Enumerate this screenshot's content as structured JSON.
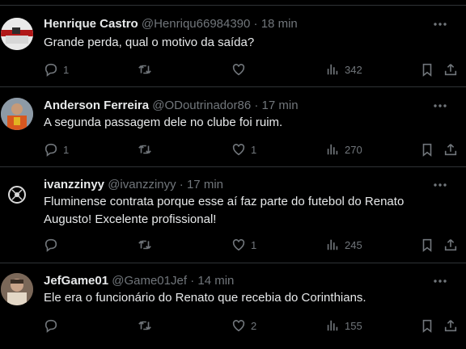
{
  "tweets": [
    {
      "name": "Henrique Castro",
      "handle": "@Henriqu66984390",
      "time": "18 min",
      "text": "Grande perda, qual o motivo da saída?",
      "replies": "1",
      "retweets": "",
      "likes": "",
      "views": "342"
    },
    {
      "name": "Anderson Ferreira",
      "handle": "@ODoutrinador86",
      "time": "17 min",
      "text": "A segunda passagem dele no clube foi ruim.",
      "replies": "1",
      "retweets": "",
      "likes": "1",
      "views": "270"
    },
    {
      "name": "ivanzzinyy",
      "handle": "@ivanzzinyy",
      "time": "17 min",
      "text": "Fluminense contrata porque esse aí faz parte do futebol do Renato Augusto! Excelente profissional!",
      "replies": "",
      "retweets": "",
      "likes": "1",
      "views": "245"
    },
    {
      "name": "JefGame01",
      "handle": "@Game01Jef",
      "time": "14 min",
      "text": "Ele era o funcionário do Renato que recebia do Corinthians.",
      "replies": "",
      "retweets": "",
      "likes": "2",
      "views": "155"
    }
  ],
  "separator": "·",
  "icons": [
    "reply-icon",
    "retweet-icon",
    "like-icon",
    "views-icon",
    "bookmark-icon",
    "share-icon",
    "more-icon"
  ]
}
